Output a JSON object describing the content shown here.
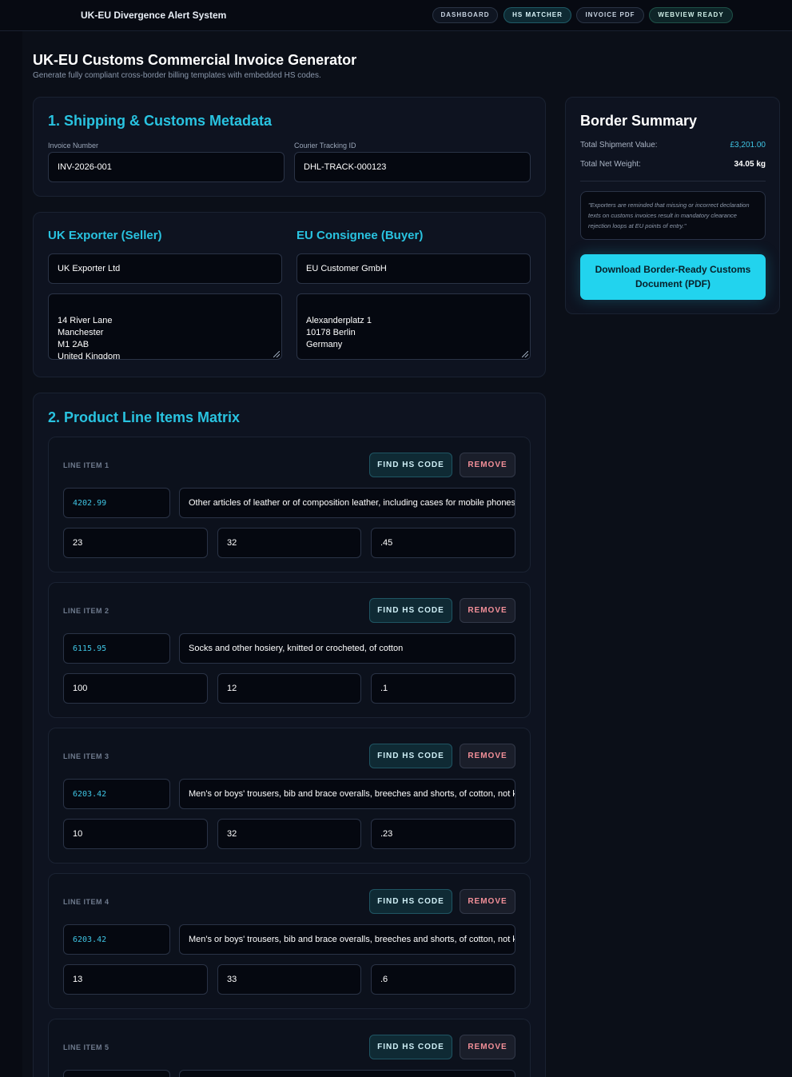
{
  "app": {
    "title": "UK-EU Divergence Alert System",
    "nav": [
      {
        "label": "DASHBOARD"
      },
      {
        "label": "HS MATCHER"
      },
      {
        "label": "INVOICE PDF"
      },
      {
        "label": "WEBVIEW READY"
      }
    ]
  },
  "page": {
    "title": "UK-EU Customs Commercial Invoice Generator",
    "subtitle": "Generate fully compliant cross-border billing templates with embedded HS codes."
  },
  "metadata": {
    "heading": "1. Shipping & Customs Metadata",
    "invoice_label": "Invoice Number",
    "invoice_value": "INV-2026-001",
    "tracking_label": "Courier Tracking ID",
    "tracking_value": "DHL-TRACK-000123"
  },
  "parties": {
    "exporter_heading": "UK Exporter (Seller)",
    "exporter_name": "UK Exporter Ltd",
    "exporter_address": "14 River Lane\nManchester\nM1 2AB\nUnited Kingdom",
    "consignee_heading": "EU Consignee (Buyer)",
    "consignee_name": "EU Customer GmbH",
    "consignee_address": "Alexanderplatz 1\n10178 Berlin\nGermany"
  },
  "products": {
    "heading": "2. Product Line Items Matrix",
    "find_label": "FIND HS CODE",
    "remove_label": "REMOVE",
    "items": [
      {
        "label": "LINE ITEM 1",
        "hs": "4202.99",
        "description": "Other articles of leather or of composition leather, including cases for mobile phones",
        "qty": "23",
        "value": "32",
        "weight": ".45"
      },
      {
        "label": "LINE ITEM 2",
        "hs": "6115.95",
        "description": "Socks and other hosiery, knitted or crocheted, of cotton",
        "qty": "100",
        "value": "12",
        "weight": ".1"
      },
      {
        "label": "LINE ITEM 3",
        "hs": "6203.42",
        "description": "Men's or boys' trousers, bib and brace overalls, breeches and shorts, of cotton, not knitted",
        "qty": "10",
        "value": "32",
        "weight": ".23"
      },
      {
        "label": "LINE ITEM 4",
        "hs": "6203.42",
        "description": "Men's or boys' trousers, bib and brace overalls, breeches and shorts, of cotton, not knitted",
        "qty": "13",
        "value": "33",
        "weight": ".6"
      },
      {
        "label": "LINE ITEM 5",
        "hs": "",
        "description": "",
        "qty": "",
        "value": "",
        "weight": ""
      }
    ]
  },
  "summary": {
    "heading": "Border Summary",
    "total_value_label": "Total Shipment Value:",
    "total_value": "£3,201.00",
    "total_weight_label": "Total Net Weight:",
    "total_weight": "34.05 kg",
    "notice": "\"Exporters are reminded that missing or incorrect declaration texts on customs invoices result in mandatory clearance rejection loops at EU points of entry.\"",
    "download_label": "Download Border-Ready Customs Document (PDF)"
  },
  "colors": {
    "accent": "#22d3ee",
    "heading": "#29c3e0",
    "background": "#0a0e17",
    "remove": "#f28f98"
  }
}
